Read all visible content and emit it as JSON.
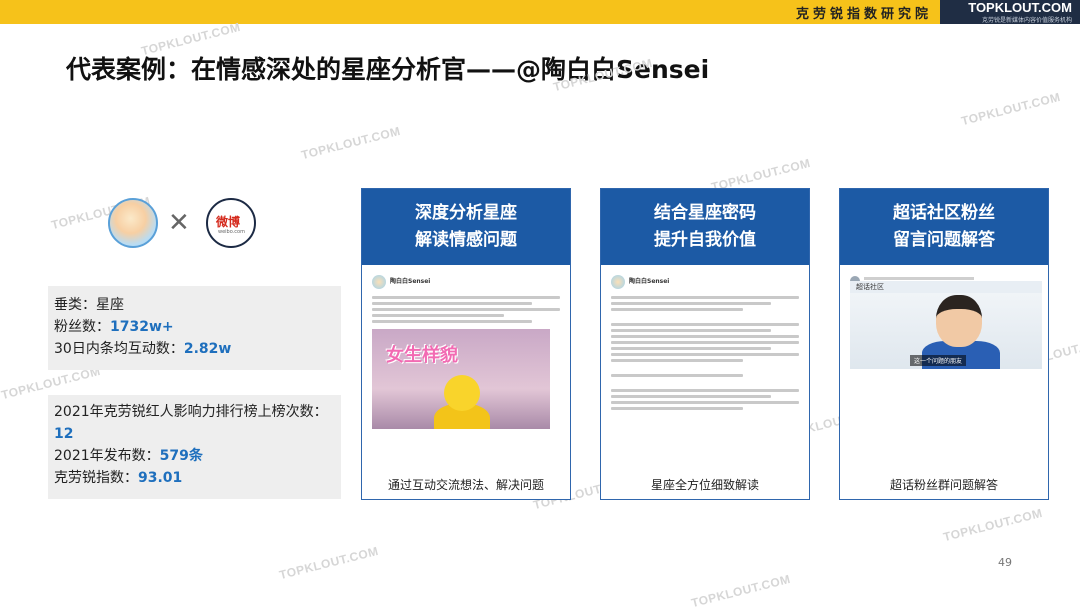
{
  "header": {
    "org": "克劳锐指数研究院",
    "brand": "TOPKLOUT.COM",
    "brand_sub": "克劳锐是新媒体内容价值服务机构"
  },
  "title": "代表案例：在情感深处的星座分析官——@陶白白Sensei",
  "watermark": "TOPKLOUT.COM",
  "logos": {
    "weibo": "微博",
    "weibo_sub": "weibo.com"
  },
  "stats1": {
    "category_label": "垂类：",
    "category_value": "星座",
    "fans_label": "粉丝数：",
    "fans_value": "1732w+",
    "interact_label": "30日内条均互动数：",
    "interact_value": "2.82w"
  },
  "stats2": {
    "rank_label": "2021年克劳锐红人影响力排行榜上榜次数：",
    "rank_value": "12",
    "posts_label": "2021年发布数：",
    "posts_value": "579条",
    "index_label": "克劳锐指数：",
    "index_value": "93.01"
  },
  "cards": [
    {
      "line1": "深度分析星座",
      "line2": "解读情感问题",
      "footer": "通过互动交流想法、解决问题",
      "user": "陶白白Sensei",
      "pic_title": "女生样貌"
    },
    {
      "line1": "结合星座密码",
      "line2": "提升自我价值",
      "footer": "星座全方位细致解读",
      "user": "陶白白Sensei"
    },
    {
      "line1": "超话社区粉丝",
      "line2": "留言问题解答",
      "footer": "超话粉丝群问题解答",
      "video_top": "超话社区",
      "subtitle": "这一个问题的朋友"
    }
  ],
  "page_number": "49"
}
